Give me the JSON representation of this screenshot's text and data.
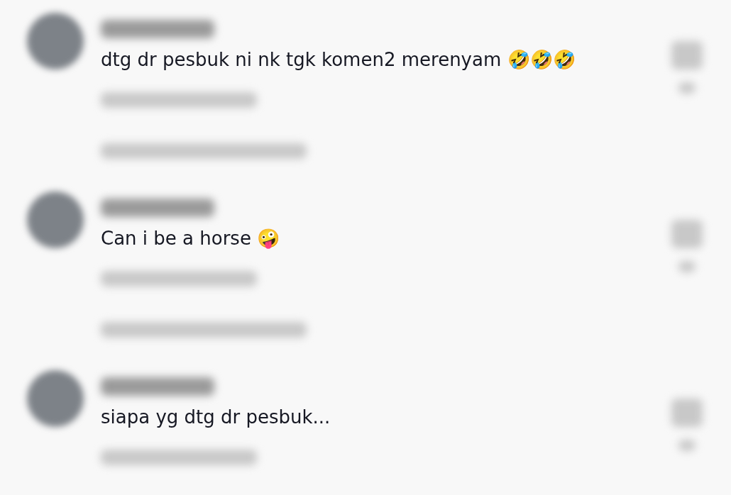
{
  "comments": [
    {
      "text": "dtg dr pesbuk ni nk tgk komen2 merenyam 🤣🤣🤣",
      "has_replies": true
    },
    {
      "text": "Can i be a horse 🤪",
      "has_replies": true
    },
    {
      "text": "siapa yg dtg dr pesbuk...",
      "has_replies": false
    }
  ]
}
